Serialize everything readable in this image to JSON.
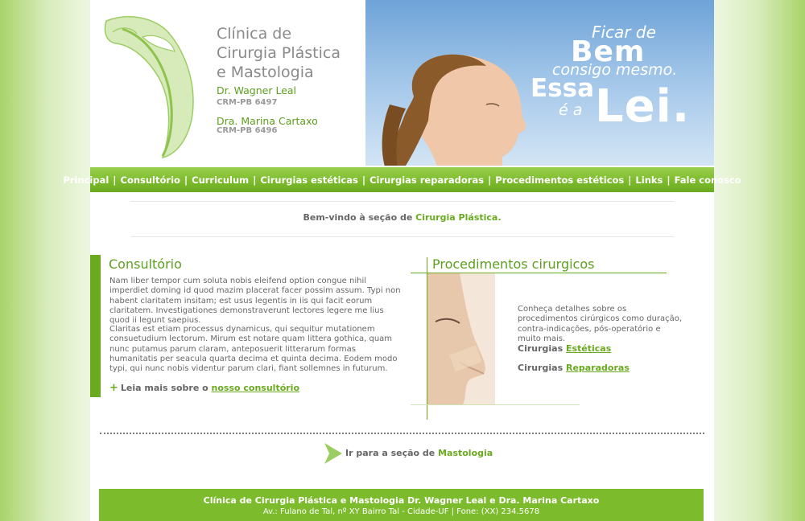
{
  "header": {
    "clinic_title_l1": "Clínica de",
    "clinic_title_l2": "Cirurgia Plástica",
    "clinic_title_l3": "e Mastologia",
    "doctor1_name": "Dr. Wagner Leal",
    "doctor1_crm": "CRM-PB 6497",
    "doctor2_name": "Dra. Marina Cartaxo",
    "doctor2_crm": "CRM-PB 6496"
  },
  "banner": {
    "line1": "Ficar de",
    "bem": "Bem",
    "line2": "consigo mesmo.",
    "essa": "Essa",
    "ea": "é a",
    "lei": "Lei."
  },
  "nav": {
    "items": [
      "Principal",
      "Consultório",
      "Curriculum",
      "Cirurgias estéticas",
      "Cirurgias reparadoras",
      "Procedimentos estéticos",
      "Links",
      "Fale conosco"
    ],
    "separator": "|"
  },
  "welcome": {
    "prefix": "Bem-vindo à seção de ",
    "highlight": "Cirurgia Plástica."
  },
  "consultorio": {
    "title": "Consultório",
    "paragraph1": "Nam liber tempor cum soluta nobis eleifend option congue nihil imperdiet doming id quod mazim placerat facer possim assum. Typi non habent claritatem insitam; est usus legentis in iis qui facit eorum claritatem. Investigationes demonstraverunt lectores legere me lius quod ii legunt saepius.",
    "paragraph2": "Claritas est etiam processus dynamicus, qui sequitur mutationem consuetudium lectorum. Mirum est notare quam littera gothica, quam nunc putamus parum claram, anteposuerit litterarum formas humanitatis per seacula quarta decima et quinta decima. Eodem modo typi, qui nunc nobis videntur parum clari, fiant sollemnes in futurum.",
    "more_plus": "+",
    "more_prefix": "Leia mais sobre o ",
    "more_link": "nosso consultório"
  },
  "procedimentos": {
    "title": "Procedimentos cirurgicos",
    "description": "Conheça detalhes sobre os procedimentos cirúrgicos como duração, contra-indicações, pós-operatório e muito mais.",
    "esteticas_prefix": "Cirurgias ",
    "esteticas_link": "Estéticas",
    "reparadoras_prefix": "Cirurgias ",
    "reparadoras_link": "Reparadoras"
  },
  "mastologia": {
    "prefix": "Ir para a seção de ",
    "link": "Mastologia"
  },
  "footer": {
    "line1": "Clínica de Cirurgia Plástica e Mastologia Dr. Wagner Leal e Dra. Marina Cartaxo",
    "line2": "Av.: Fulano de Tal, nº XY Bairro Tal - Cidade-UF | Fone: (XX) 234.5678"
  },
  "colors": {
    "brand_green": "#6aaa1f",
    "nav_green": "#7cbb2c",
    "text_gray": "#666666",
    "banner_blue": "#6ea3d8"
  },
  "icons": {
    "logo": "figure-swoosh-logo",
    "mastologia_arrow": "triangle-arrow-right-icon"
  }
}
